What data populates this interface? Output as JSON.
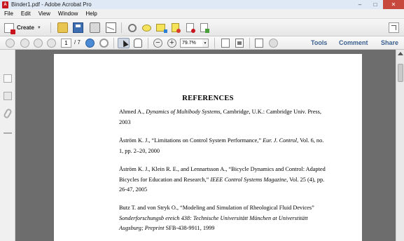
{
  "window": {
    "title": "Binder1.pdf - Adobe Acrobat Pro",
    "minimize": "–",
    "maximize": "□",
    "close": "✕"
  },
  "menu": [
    "File",
    "Edit",
    "View",
    "Window",
    "Help"
  ],
  "toolbar": {
    "create_label": "Create",
    "create_arrow": "▼",
    "icons": [
      "folder-open-icon",
      "save-icon",
      "print-icon",
      "email-icon",
      "gear-icon",
      "comment-icon",
      "sticky-note-icon",
      "highlight-icon",
      "pdf-icon",
      "export-icon",
      "expand-icon"
    ]
  },
  "navbar": {
    "current_page": "1",
    "total_pages": "/ 7",
    "zoom": "79.7%",
    "zoom_arrow": "▼",
    "links": {
      "tools": "Tools",
      "comment": "Comment",
      "share": "Share"
    }
  },
  "document": {
    "heading": "REFERENCES",
    "refs": [
      {
        "pre": "Ahmed A., ",
        "ital": "Dynamics of Multibody Systems",
        "post": ", Cambridge, U.K.: Cambridge Univ. Press, 2003"
      },
      {
        "pre": "Åström K. J., “Limitations on Control System Performance,” ",
        "ital": "Eur. J. Control,",
        "post": " Vol. 6, no. 1, pp. 2–20, 2000"
      },
      {
        "pre": "Åström K. J., Klein R. E., and Lennartsson A., “Bicycle Dynamics and Control: Adapted Bicycles for Education and Research,” ",
        "ital": "IEEE Control Systems Magazine,",
        "post": " Vol. 25 (4), pp. 26-47, 2005"
      },
      {
        "pre": "Butz T. and von Stryk O., “Modeling and Simulation of Rheological Fluid Devices” ",
        "ital": "Sonderforschungsb ereich 438: Technische Universitätt München at Universtitätt Augsburg; Preprint",
        "post": " SFB-438-9911, 1999"
      }
    ]
  }
}
